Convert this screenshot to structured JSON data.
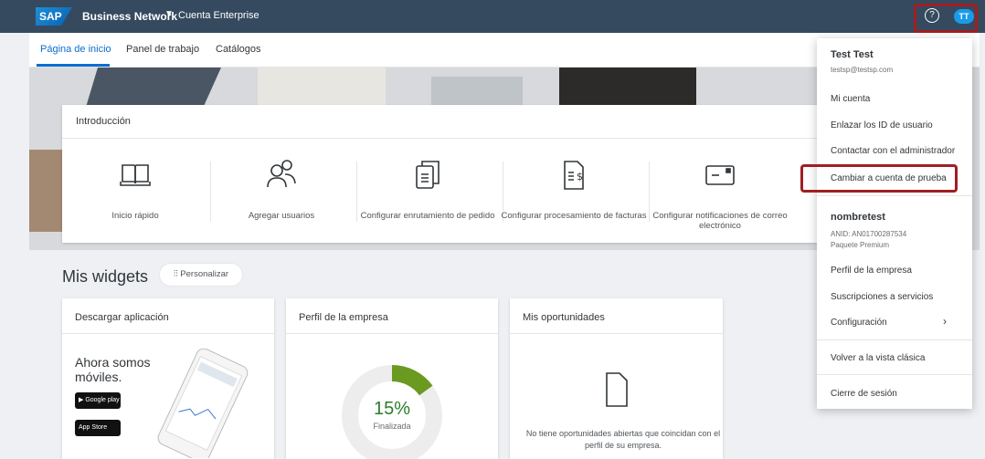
{
  "shellbar": {
    "logo": "SAP",
    "title": "Business Network",
    "subtitle": "Cuenta Enterprise",
    "help_icon": "?",
    "avatar": "TT"
  },
  "tabs": [
    "Página de inicio",
    "Panel de trabajo",
    "Catálogos"
  ],
  "intro": {
    "title": "Introducción",
    "tiles": [
      "Inicio rápido",
      "Agregar usuarios",
      "Configurar enrutamiento de pedido",
      "Configurar procesamiento de facturas",
      "Configurar notificaciones de correo electrónico"
    ]
  },
  "widgets": {
    "title": "Mis widgets",
    "personalize": "Personalizar",
    "cards": {
      "download": {
        "title": "Descargar aplicación",
        "text": "Ahora somos móviles.",
        "google": "Google play",
        "apple": "App Store"
      },
      "profile": {
        "title": "Perfil de la empresa",
        "percent": "15%",
        "status": "Finalizada",
        "progress": 0.15
      },
      "opportunities": {
        "title": "Mis oportunidades",
        "empty": "No tiene oportunidades abiertas que coincidan con el perfil de su empresa."
      }
    }
  },
  "menu": {
    "user_name": "Test Test",
    "user_email": "testsp@testsp.com",
    "my_account": "Mi cuenta",
    "link_ids": "Enlazar los ID de usuario",
    "contact_admin": "Contactar con el administrador",
    "switch_test": "Cambiar a cuenta de prueba",
    "company_name": "nombretest",
    "anid": "ANID: AN01700287534",
    "package": "Paquete Premium",
    "company_profile": "Perfil de la empresa",
    "subscriptions": "Suscripciones a servicios",
    "settings": "Configuración",
    "classic_view": "Volver a la vista clásica",
    "logout": "Cierre de sesión"
  },
  "colors": {
    "shell": "#354a5f",
    "accent": "#0a6ed1",
    "highlight": "#a11e22",
    "progress": "#6a9a1f"
  }
}
